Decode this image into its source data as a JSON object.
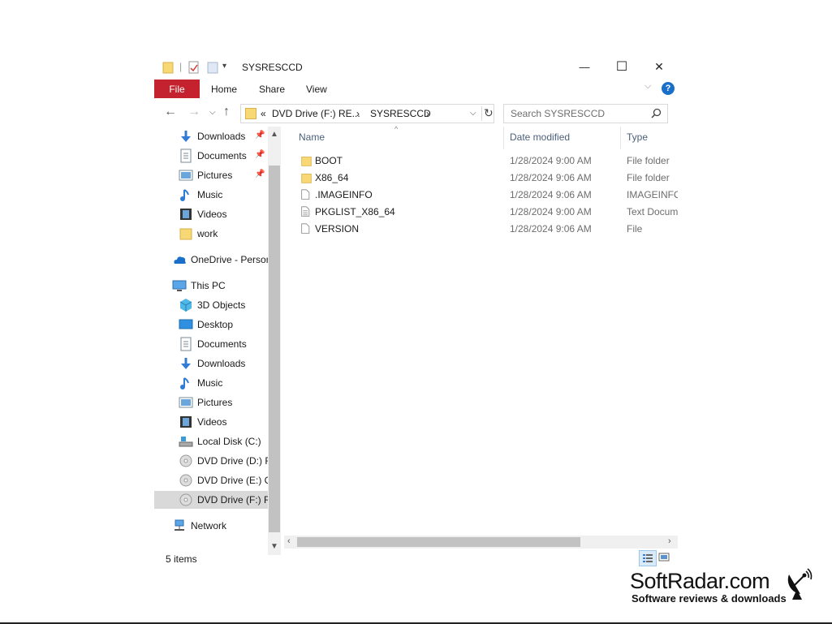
{
  "window": {
    "title": "SYSRESCCD",
    "controls": {
      "minimize": "—",
      "maximize": "☐",
      "close": "✕"
    }
  },
  "ribbon": {
    "tabs": [
      "File",
      "Home",
      "Share",
      "View"
    ],
    "help": "?"
  },
  "address": {
    "prefix": "«",
    "crumb1": "DVD Drive (F:) RE...",
    "sep": "›",
    "crumb2": "SYSRESCCD"
  },
  "search": {
    "placeholder": "Search SYSRESCCD"
  },
  "nav": {
    "items": [
      {
        "label": "Downloads",
        "icon": "download-icon",
        "pinned": true
      },
      {
        "label": "Documents",
        "icon": "document-icon",
        "pinned": true
      },
      {
        "label": "Pictures",
        "icon": "pictures-icon",
        "pinned": true
      },
      {
        "label": "Music",
        "icon": "music-icon",
        "pinned": false
      },
      {
        "label": "Videos",
        "icon": "videos-icon",
        "pinned": false
      },
      {
        "label": "work",
        "icon": "folder-icon",
        "pinned": false
      },
      {
        "label": "OneDrive - Persor",
        "icon": "onedrive-icon",
        "pinned": false
      },
      {
        "label": "This PC",
        "icon": "this-pc-icon",
        "pinned": false
      },
      {
        "label": "3D Objects",
        "icon": "3d-objects-icon",
        "pinned": false
      },
      {
        "label": "Desktop",
        "icon": "desktop-icon",
        "pinned": false
      },
      {
        "label": "Documents",
        "icon": "document-icon",
        "pinned": false
      },
      {
        "label": "Downloads",
        "icon": "download-icon",
        "pinned": false
      },
      {
        "label": "Music",
        "icon": "music-icon",
        "pinned": false
      },
      {
        "label": "Pictures",
        "icon": "pictures-icon",
        "pinned": false
      },
      {
        "label": "Videos",
        "icon": "videos-icon",
        "pinned": false
      },
      {
        "label": "Local Disk (C:)",
        "icon": "local-disk-icon",
        "pinned": false
      },
      {
        "label": "DVD Drive (D:) R",
        "icon": "dvd-drive-icon",
        "pinned": false
      },
      {
        "label": "DVD Drive (E:) Cl",
        "icon": "dvd-drive-icon",
        "pinned": false
      },
      {
        "label": "DVD Drive (F:) RE",
        "icon": "dvd-drive-icon",
        "pinned": false
      },
      {
        "label": "Network",
        "icon": "network-icon",
        "pinned": false
      }
    ]
  },
  "columns": {
    "name": "Name",
    "date": "Date modified",
    "type": "Type"
  },
  "files": [
    {
      "name": "BOOT",
      "date": "1/28/2024 9:00 AM",
      "type": "File folder",
      "icon": "folder-icon"
    },
    {
      "name": "X86_64",
      "date": "1/28/2024 9:06 AM",
      "type": "File folder",
      "icon": "folder-icon"
    },
    {
      "name": ".IMAGEINFO",
      "date": "1/28/2024 9:06 AM",
      "type": "IMAGEINFO",
      "icon": "file-icon"
    },
    {
      "name": "PKGLIST_X86_64",
      "date": "1/28/2024 9:00 AM",
      "type": "Text Docum",
      "icon": "text-file-icon"
    },
    {
      "name": "VERSION",
      "date": "1/28/2024 9:06 AM",
      "type": "File",
      "icon": "file-icon"
    }
  ],
  "status": {
    "count": "5 items"
  },
  "watermark": {
    "title": "SoftRadar.com",
    "subtitle": "Software reviews & downloads"
  },
  "colors": {
    "file_tab": "#c4222e",
    "selected": "#d9d9d9",
    "folder": "#f8d775",
    "accent": "#1a6fc9"
  }
}
